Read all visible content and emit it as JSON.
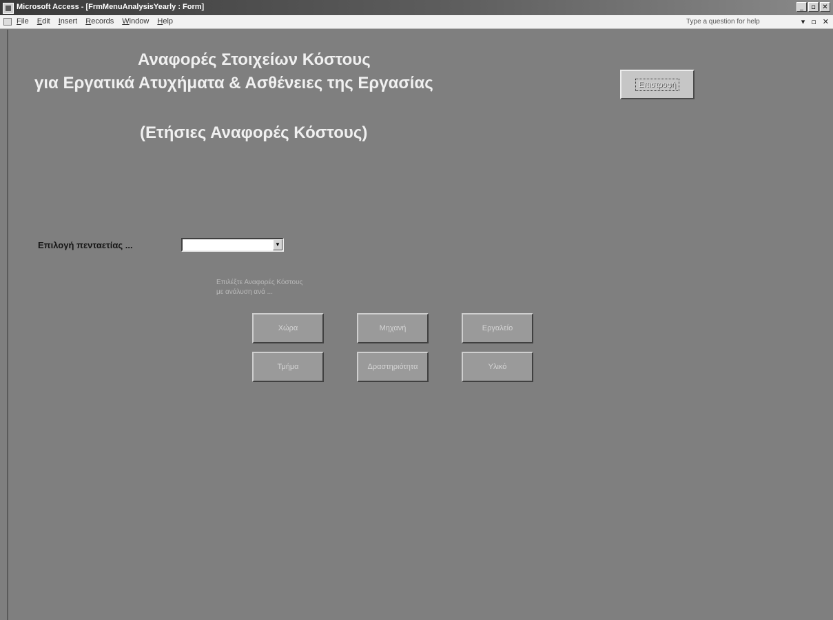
{
  "window": {
    "title": "Microsoft Access - [FrmMenuAnalysisYearly : Form]",
    "controls": {
      "minimize": "_",
      "restore": "▫",
      "close": "✕"
    }
  },
  "menubar": {
    "items": [
      {
        "accel": "F",
        "rest": "ile"
      },
      {
        "accel": "E",
        "rest": "dit"
      },
      {
        "accel": "I",
        "rest": "nsert"
      },
      {
        "accel": "R",
        "rest": "ecords"
      },
      {
        "accel": "W",
        "rest": "indow"
      },
      {
        "accel": "H",
        "rest": "elp"
      }
    ],
    "help_placeholder": "Type a question for help",
    "doc_controls": {
      "dropdown": "▾",
      "restore": "▫",
      "close": "✕"
    }
  },
  "form": {
    "heading_line1": "Αναφορές Στοιχείων Κόστους",
    "heading_line2": "για Εργατικά Ατυχήματα & Ασθένειες της Εργασίας",
    "heading_line3": "(Ετήσιες Αναφορές Κόστους)",
    "return_button": "Επιστροφή",
    "period_label": "Επιλογή πενταετίας ...",
    "period_value": "",
    "combo_arrow": "▼",
    "hint_line1": "Επιλέξτε Αναφορές Κόστους",
    "hint_line2": "με ανάλυση ανά ...",
    "buttons": {
      "country": "Χώρα",
      "machine": "Μηχανή",
      "tool": "Εργαλείο",
      "department": "Τμήμα",
      "activity": "Δραστηριότητα",
      "material": "Υλικό"
    }
  }
}
